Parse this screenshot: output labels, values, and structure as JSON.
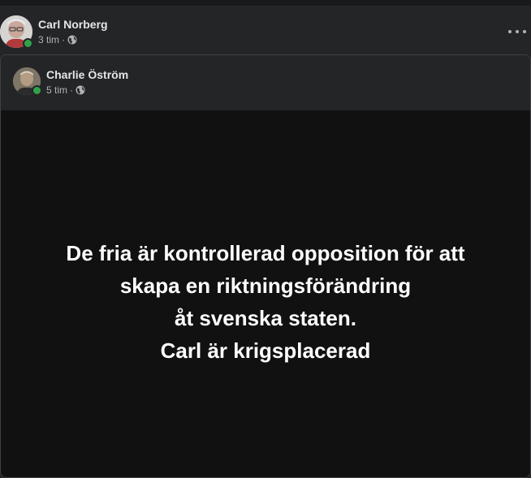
{
  "post": {
    "author_name": "Carl Norberg",
    "time": "3 tim",
    "separator": "·",
    "privacy_icon": "globe-icon",
    "more_icon": "more-options-icon"
  },
  "shared": {
    "author_name": "Charlie Öström",
    "time": "5 tim",
    "separator": "·",
    "privacy_icon": "globe-icon",
    "text_lines": [
      "De fria är kontrollerad opposition för att",
      "skapa en riktningsförändring",
      "åt svenska staten.",
      "Carl är krigsplacerad"
    ]
  },
  "colors": {
    "background": "#242526",
    "card_body": "#111112",
    "online_status": "#31a24c",
    "secondary_text": "#b0b3b8"
  }
}
